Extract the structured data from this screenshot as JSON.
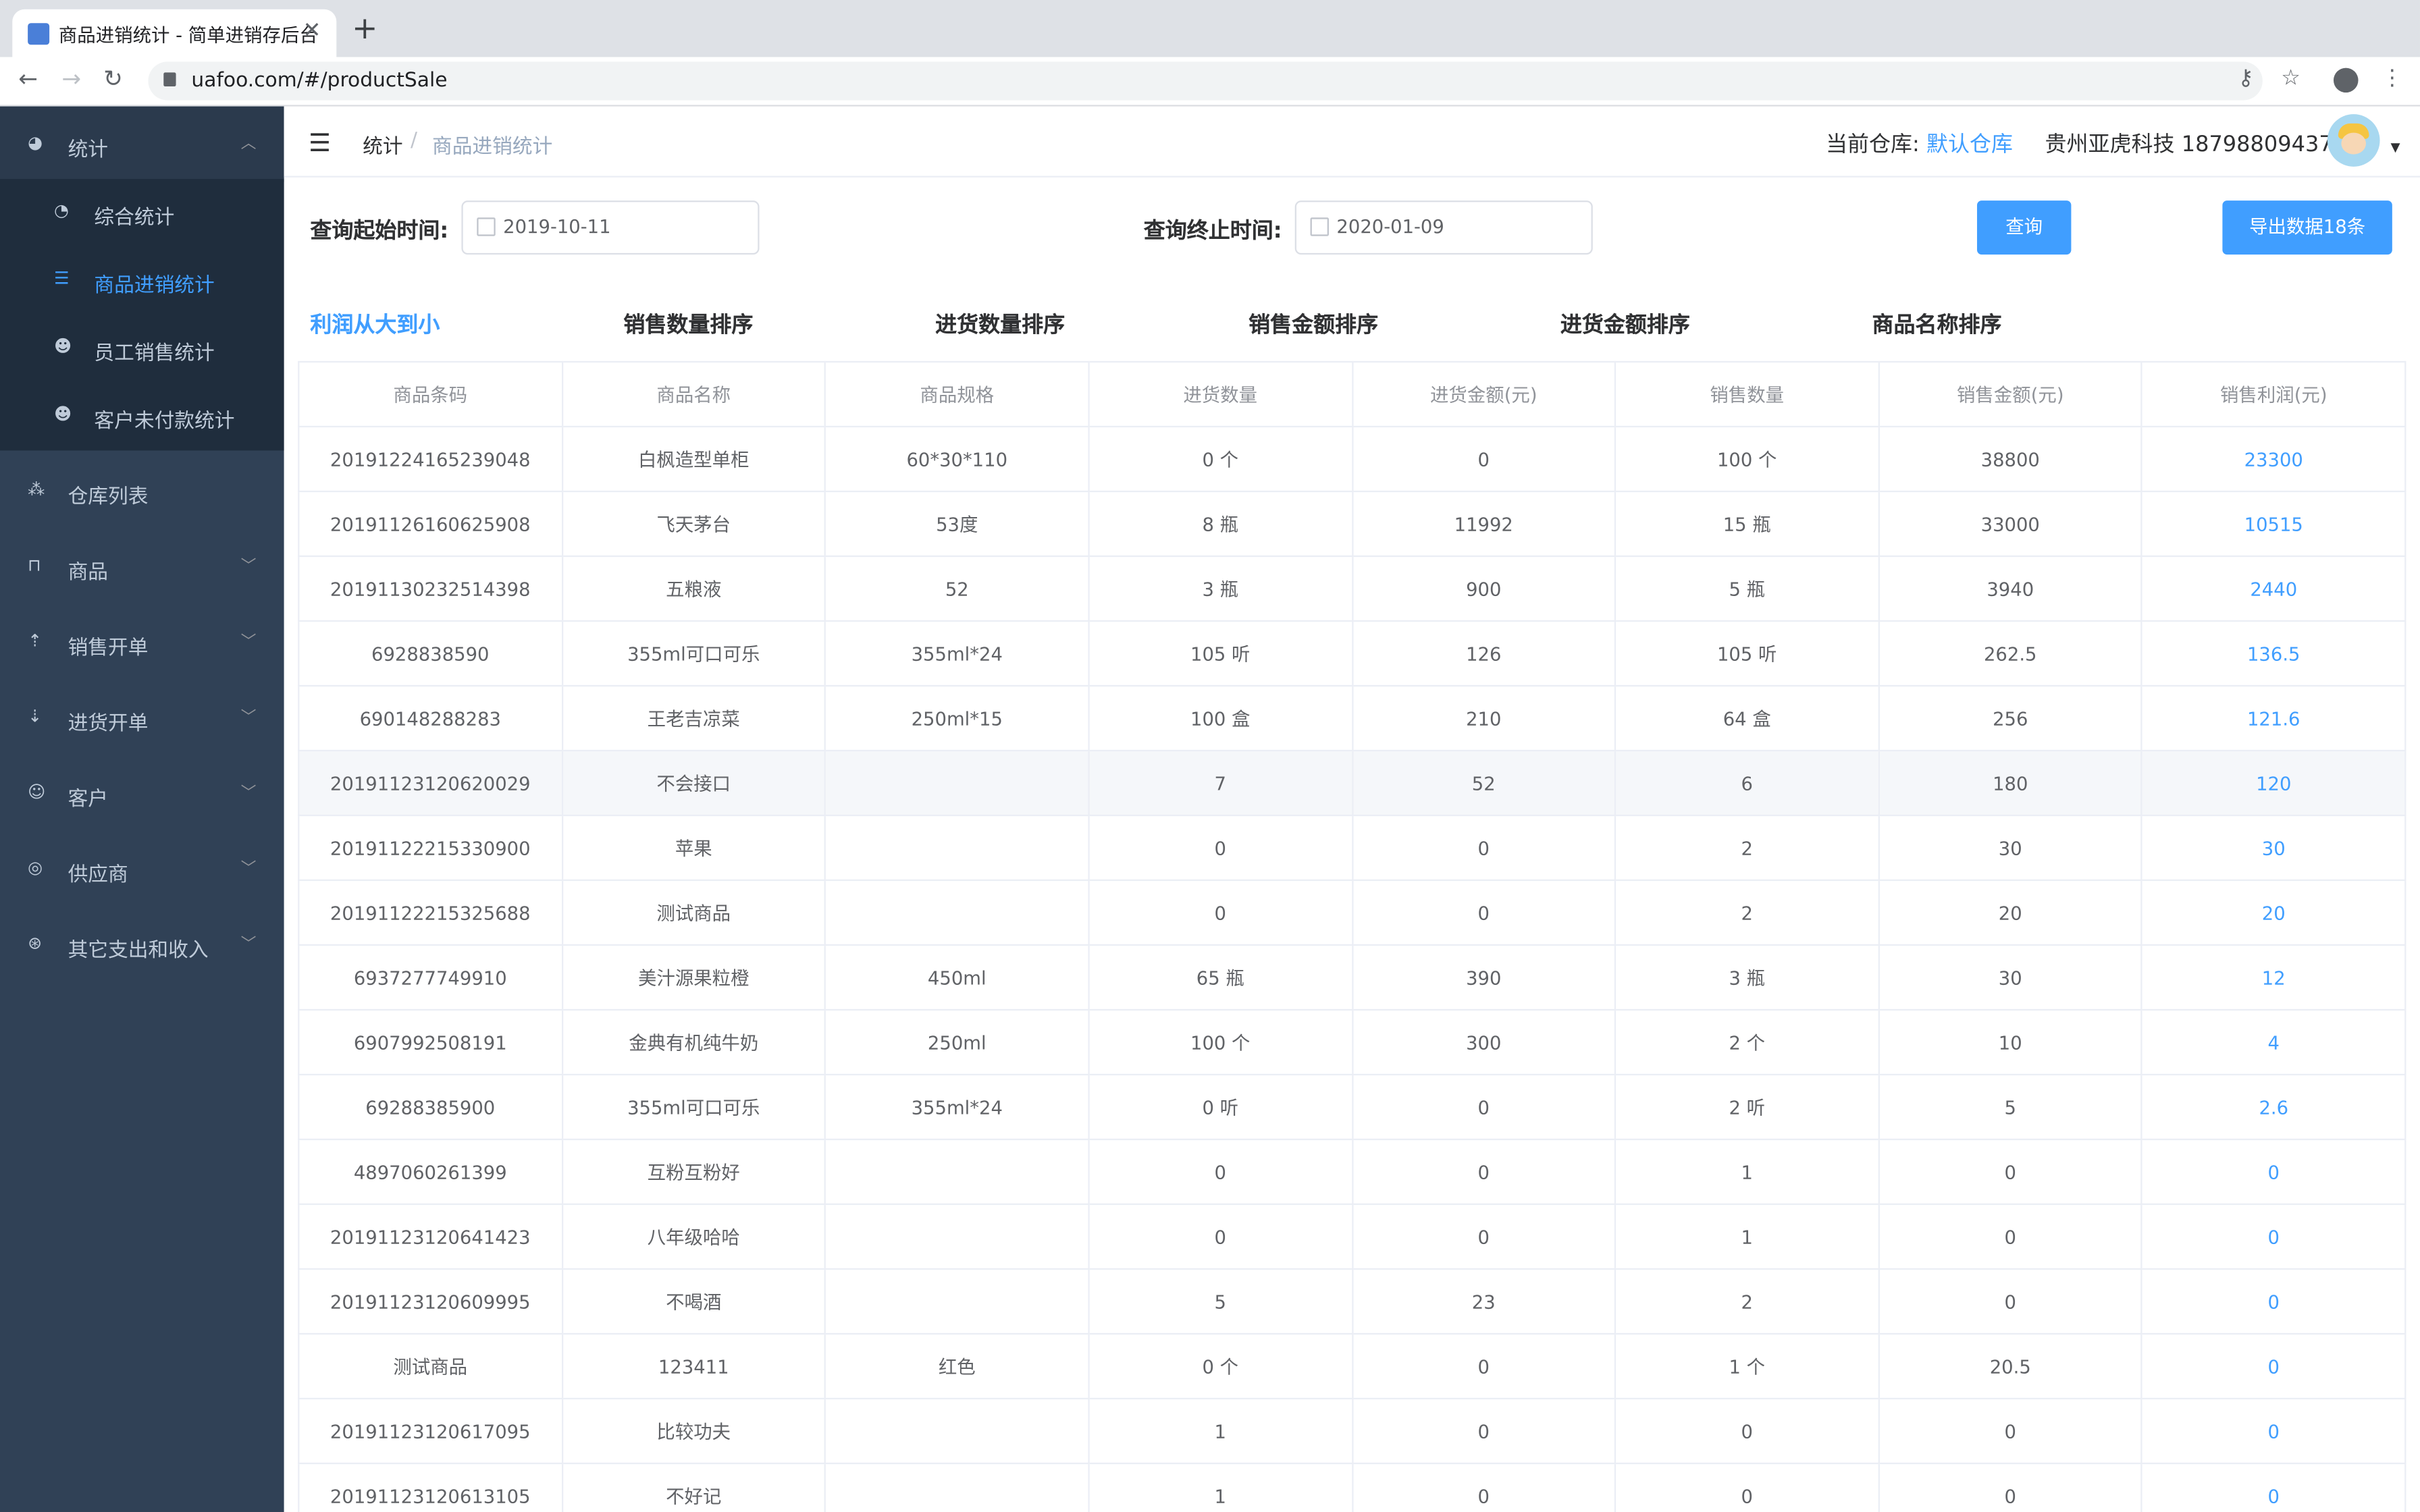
{
  "browser": {
    "tab_title": "商品进销统计 - 简单进销存后台",
    "tab_close": "✕",
    "new_tab": "+",
    "url": "uafoo.com/#/productSale"
  },
  "sidebar": {
    "items": [
      {
        "label": "统计",
        "icon": "pie-chart-icon",
        "expanded": true
      },
      {
        "label": "仓库列表",
        "icon": "warehouse-icon"
      },
      {
        "label": "商品",
        "icon": "bag-icon"
      },
      {
        "label": "销售开单",
        "icon": "upload-icon"
      },
      {
        "label": "进货开单",
        "icon": "download-icon"
      },
      {
        "label": "客户",
        "icon": "user-icon"
      },
      {
        "label": "供应商",
        "icon": "supplier-icon"
      },
      {
        "label": "其它支出和收入",
        "icon": "coin-icon"
      }
    ],
    "sub_items": [
      {
        "label": "综合统计",
        "icon": "dashboard-icon"
      },
      {
        "label": "商品进销统计",
        "icon": "search-list-icon",
        "active": true
      },
      {
        "label": "员工销售统计",
        "icon": "staff-icon"
      },
      {
        "label": "客户未付款统计",
        "icon": "customer-icon"
      }
    ]
  },
  "header": {
    "breadcrumb": [
      "统计",
      "商品进销统计"
    ],
    "breadcrumb_sep": "/",
    "warehouse_label": "当前仓库: ",
    "warehouse_value": "默认仓库",
    "user": "贵州亚虎科技 18798809437"
  },
  "filters": {
    "start_label": "查询起始时间:",
    "start_value": "2019-10-11",
    "end_label": "查询终止时间:",
    "end_value": "2020-01-09",
    "query_button": "查询",
    "export_button": "导出数据18条"
  },
  "sort_tabs": [
    "利润从大到小",
    "销售数量排序",
    "进货数量排序",
    "销售金额排序",
    "进货金额排序",
    "商品名称排序"
  ],
  "table": {
    "columns": [
      "商品条码",
      "商品名称",
      "商品规格",
      "进货数量",
      "进货金额(元)",
      "销售数量",
      "销售金额(元)",
      "销售利润(元)"
    ],
    "rows": [
      [
        "20191224165239048",
        "白枫造型单柜",
        "60*30*110",
        "0 个",
        "0",
        "100 个",
        "38800",
        "23300"
      ],
      [
        "20191126160625908",
        "飞天茅台",
        "53度",
        "8 瓶",
        "11992",
        "15 瓶",
        "33000",
        "10515"
      ],
      [
        "20191130232514398",
        "五粮液",
        "52",
        "3 瓶",
        "900",
        "5 瓶",
        "3940",
        "2440"
      ],
      [
        "6928838590",
        "355ml可口可乐",
        "355ml*24",
        "105 听",
        "126",
        "105 听",
        "262.5",
        "136.5"
      ],
      [
        "690148288283",
        "王老吉凉菜",
        "250ml*15",
        "100 盒",
        "210",
        "64 盒",
        "256",
        "121.6"
      ],
      [
        "20191123120620029",
        "不会接口",
        "",
        "7",
        "52",
        "6",
        "180",
        "120"
      ],
      [
        "20191122215330900",
        "苹果",
        "",
        "0",
        "0",
        "2",
        "30",
        "30"
      ],
      [
        "20191122215325688",
        "测试商品",
        "",
        "0",
        "0",
        "2",
        "20",
        "20"
      ],
      [
        "6937277749910",
        "美汁源果粒橙",
        "450ml",
        "65 瓶",
        "390",
        "3 瓶",
        "30",
        "12"
      ],
      [
        "6907992508191",
        "金典有机纯牛奶",
        "250ml",
        "100 个",
        "300",
        "2 个",
        "10",
        "4"
      ],
      [
        "69288385900",
        "355ml可口可乐",
        "355ml*24",
        "0 听",
        "0",
        "2 听",
        "5",
        "2.6"
      ],
      [
        "4897060261399",
        "互粉互粉好",
        "",
        "0",
        "0",
        "1",
        "0",
        "0"
      ],
      [
        "20191123120641423",
        "八年级哈哈",
        "",
        "0",
        "0",
        "1",
        "0",
        "0"
      ],
      [
        "20191123120609995",
        "不喝酒",
        "",
        "5",
        "23",
        "2",
        "0",
        "0"
      ],
      [
        "测试商品",
        "123411",
        "红色",
        "0 个",
        "0",
        "1 个",
        "20.5",
        "0"
      ],
      [
        "20191123120617095",
        "比较功夫",
        "",
        "1",
        "0",
        "0",
        "0",
        "0"
      ],
      [
        "20191123120613105",
        "不好记",
        "",
        "1",
        "0",
        "0",
        "0",
        "0"
      ]
    ]
  },
  "colors": {
    "sidebar_bg": "#304156",
    "submenu_bg": "#1f2d3d",
    "accent": "#409eff"
  }
}
